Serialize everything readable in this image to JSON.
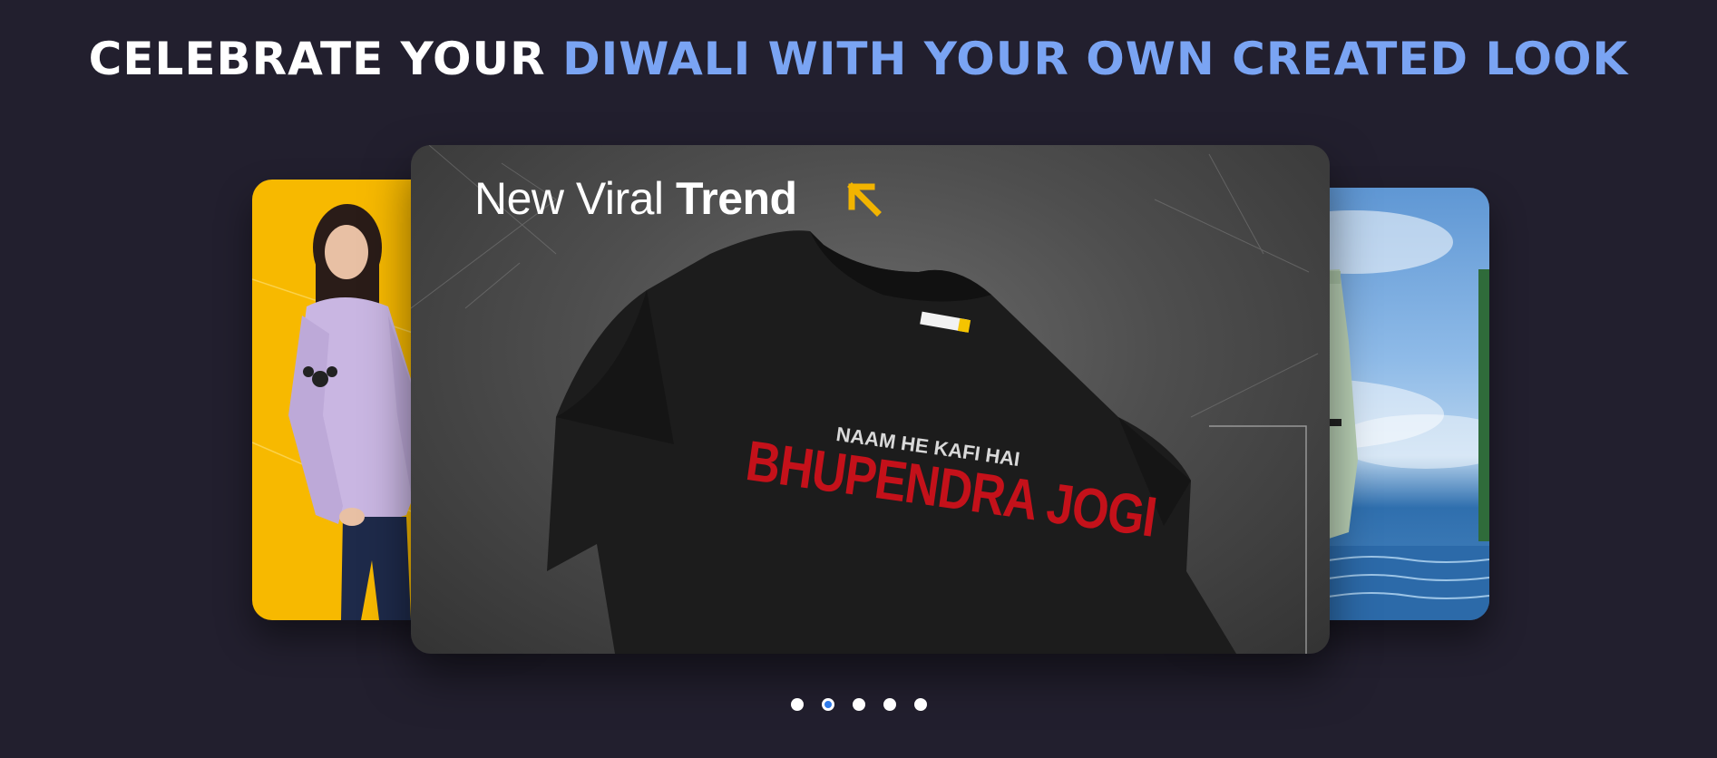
{
  "headline": {
    "part1": "CELEBRATE YOUR",
    "part2": "DIWALI WITH YOUR OWN CREATED LOOK"
  },
  "carousel": {
    "active_index": 1,
    "slides_count": 5,
    "main_slide": {
      "tag_light": "New Viral",
      "tag_bold": "Trend",
      "arrow_icon": "arrow-up-left-icon",
      "print_line1": "NAAM HE KAFI HAI",
      "print_line2": "BHUPENDRA JOGI"
    },
    "left_slide": {
      "subject": "woman in lavender hoodie on yellow background"
    },
    "right_slide": {
      "subject": "mint cargo joggers against sky and sea"
    }
  },
  "colors": {
    "background": "#221f2e",
    "headline_white": "#ffffff",
    "headline_blue": "#7aa4f3",
    "arrow_yellow": "#f2b400",
    "print_red": "#c4111a",
    "dot_active": "#2f7bea"
  }
}
